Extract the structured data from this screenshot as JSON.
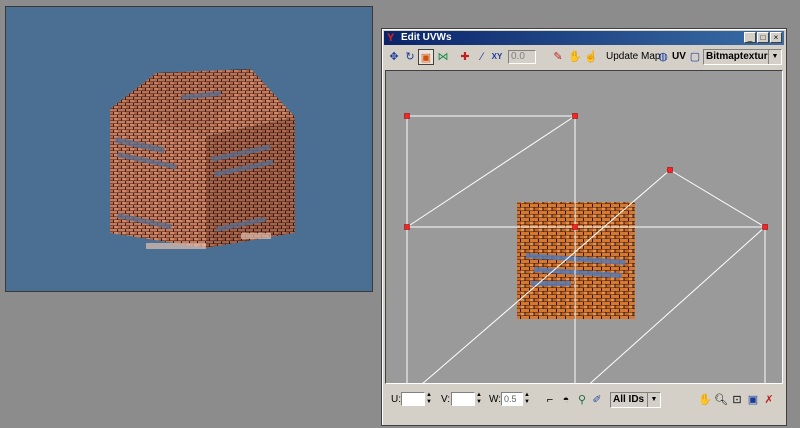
{
  "window": {
    "title": "Edit UVWs",
    "minimize": "_",
    "maximize": "□",
    "close": "×"
  },
  "toolbar": {
    "value_field": "0.0",
    "update_map_label": "Update Map",
    "uv_label": "UV",
    "map_dropdown": "Bitmaptexture"
  },
  "bottom": {
    "u_label": "U:",
    "v_label": "V:",
    "w_label": "W:",
    "w_value": "0.5",
    "ids_dropdown": "All IDs"
  },
  "colors": {
    "viewport_bg": "#4b6f92",
    "uv_canvas_bg": "#9a9a9a",
    "edge": "#ffffff",
    "vertex": "#ff0000",
    "brick": "#c87450"
  }
}
